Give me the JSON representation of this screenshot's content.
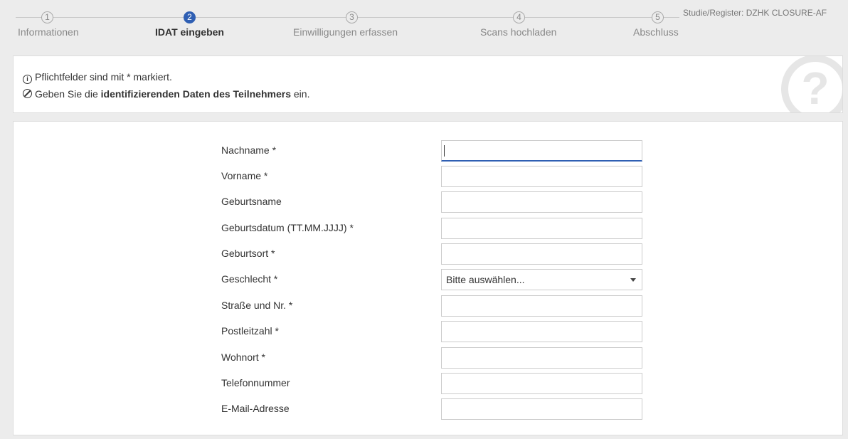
{
  "stepper": {
    "steps": [
      {
        "number": "1",
        "label": "Informationen"
      },
      {
        "number": "2",
        "label": "IDAT eingeben"
      },
      {
        "number": "3",
        "label": "Einwilligungen erfassen"
      },
      {
        "number": "4",
        "label": "Scans hochladen"
      },
      {
        "number": "5",
        "label": "Abschluss"
      }
    ],
    "active_step": 2,
    "study_label": "Studie/Register: DZHK CLOSURE-AF"
  },
  "info": {
    "line1": "Pflichtfelder sind mit * markiert.",
    "line2_prefix": "Geben Sie die ",
    "line2_bold": "identifizierenden Daten des Teilnehmers",
    "line2_suffix": " ein.",
    "icon1": "info-circle-icon",
    "icon2": "ban-circle-icon",
    "watermark_icon": "question-circle-icon",
    "watermark_glyph": "?"
  },
  "form": {
    "fields": [
      {
        "label": "Nachname *",
        "value": ""
      },
      {
        "label": "Vorname *",
        "value": ""
      },
      {
        "label": "Geburtsname",
        "value": ""
      },
      {
        "label": "Geburtsdatum (TT.MM.JJJJ) *",
        "value": ""
      },
      {
        "label": "Geburtsort *",
        "value": ""
      },
      {
        "label": "Geschlecht *",
        "value": "Bitte auswählen..."
      },
      {
        "label": "Straße und Nr. *",
        "value": ""
      },
      {
        "label": "Postleitzahl *",
        "value": ""
      },
      {
        "label": "Wohnort *",
        "value": ""
      },
      {
        "label": "Telefonnummer",
        "value": ""
      },
      {
        "label": "E-Mail-Adresse",
        "value": ""
      }
    ]
  },
  "colors": {
    "accent": "#2f5fb3",
    "background": "#ececec"
  }
}
